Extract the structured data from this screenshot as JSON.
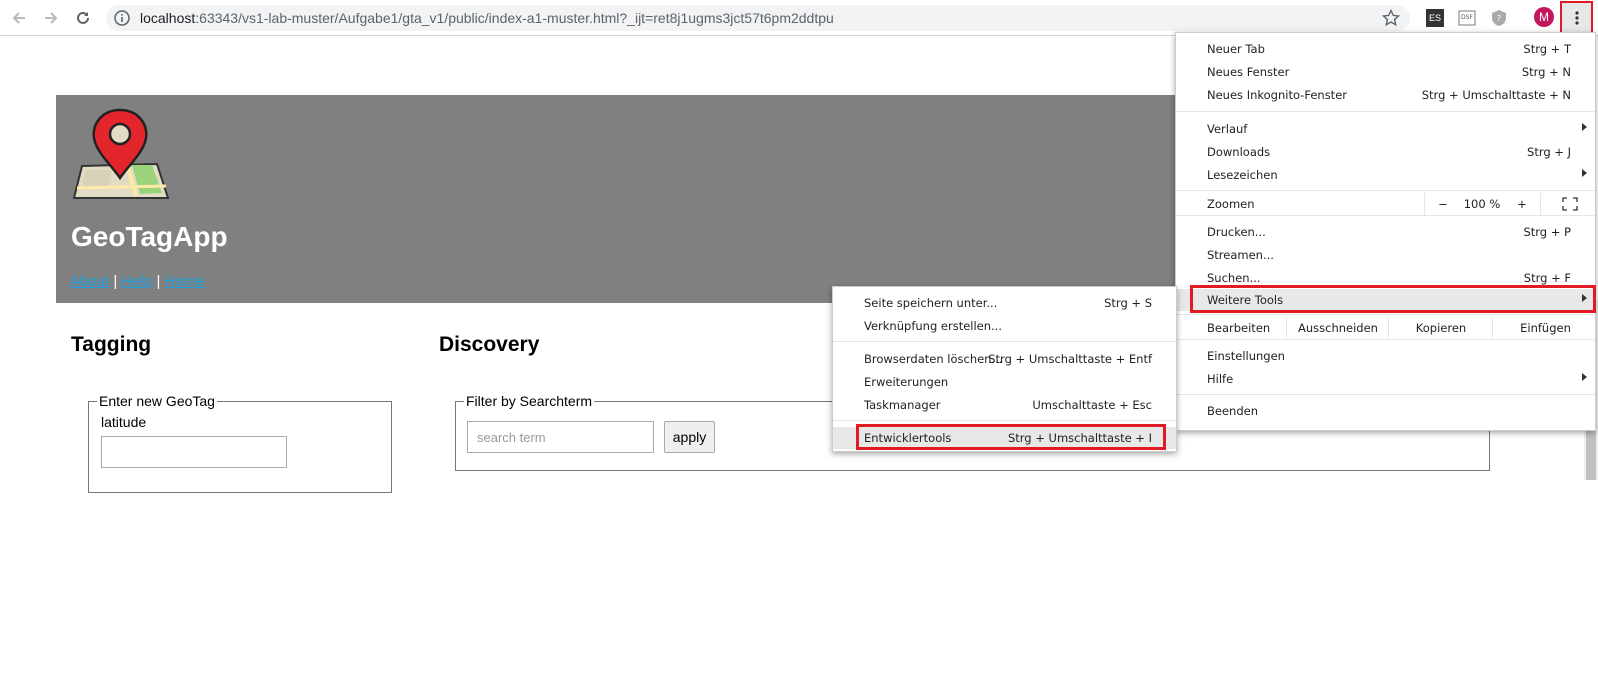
{
  "browser": {
    "url_host": "localhost",
    "url_rest": ":63343/vs1-lab-muster/Aufgabe1/gta_v1/public/index-a1-muster.html?_ijt=ret8j1ugms3jct57t6pm2ddtpu",
    "ext_es": "ES",
    "ext_dsf": "DSF",
    "avatar": "M"
  },
  "page": {
    "app_title": "GeoTagApp",
    "nav": {
      "about": "About",
      "help": "Help",
      "home": "Home",
      "sep": "|"
    },
    "tagging": {
      "title": "Tagging",
      "legend": "Enter new GeoTag",
      "latitude_label": "latitude"
    },
    "discovery": {
      "title": "Discovery",
      "legend": "Filter by Searchterm",
      "search_placeholder": "search term",
      "apply_label": "apply"
    }
  },
  "main_menu": {
    "new_tab": "Neuer Tab",
    "new_tab_sc": "Strg + T",
    "new_window": "Neues Fenster",
    "new_window_sc": "Strg + N",
    "incognito": "Neues Inkognito-Fenster",
    "incognito_sc": "Strg + Umschalttaste + N",
    "history": "Verlauf",
    "downloads": "Downloads",
    "downloads_sc": "Strg + J",
    "bookmarks": "Lesezeichen",
    "zoom": "Zoomen",
    "zoom_minus": "−",
    "zoom_value": "100 %",
    "zoom_plus": "+",
    "print": "Drucken...",
    "print_sc": "Strg + P",
    "cast": "Streamen...",
    "find": "Suchen...",
    "find_sc": "Strg + F",
    "more_tools": "Weitere Tools",
    "edit": "Bearbeiten",
    "cut": "Ausschneiden",
    "copy": "Kopieren",
    "paste": "Einfügen",
    "settings": "Einstellungen",
    "help": "Hilfe",
    "exit": "Beenden"
  },
  "sub_menu": {
    "save_page": "Seite speichern unter...",
    "save_page_sc": "Strg + S",
    "create_shortcut": "Verknüpfung erstellen...",
    "clear_data": "Browserdaten löschen...",
    "clear_data_sc": "Strg + Umschalttaste + Entf",
    "extensions": "Erweiterungen",
    "task_manager": "Taskmanager",
    "task_manager_sc": "Umschalttaste + Esc",
    "dev_tools": "Entwicklertools",
    "dev_tools_sc": "Strg + Umschalttaste + I"
  },
  "colors": {
    "banner": "#808080",
    "highlight": "#e01b24",
    "link": "#1ba1e2"
  }
}
